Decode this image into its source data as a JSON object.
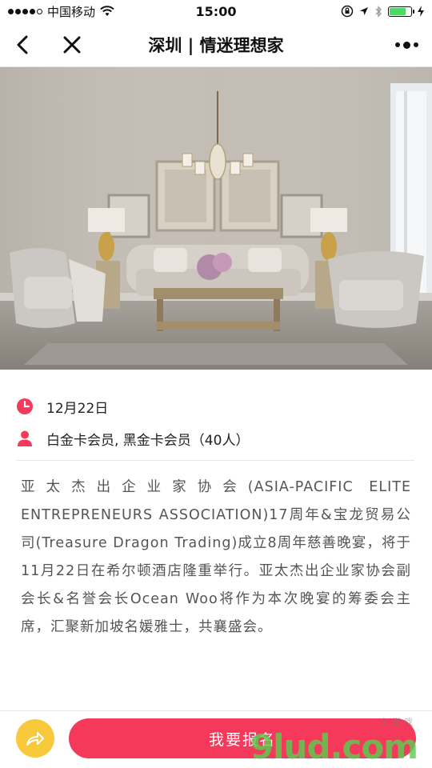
{
  "status_bar": {
    "carrier": "中国移动",
    "time": "15:00",
    "battery_level": 0.75,
    "icons": [
      "signal-dots-icon",
      "wifi-icon",
      "lock-rotation-icon",
      "location-arrow-icon",
      "bluetooth-icon",
      "battery-icon",
      "charging-icon"
    ]
  },
  "nav": {
    "title": "深圳 | 情迷理想家",
    "icons": [
      "back-arrow-icon",
      "close-icon",
      "more-dots-icon"
    ]
  },
  "event": {
    "date": "12月22日",
    "audience": "白金卡会员, 黑金卡会员（40人）",
    "description": "亚太杰出企业家协会(ASIA-PACIFIC ELITE ENTREPRENEURS ASSOCIATION)17周年&宝龙贸易公司(Treasure Dragon Trading)成立8周年慈善晚宴，将于11月22日在希尔顿酒店隆重举行。亚太杰出企业家协会副会长&名誉会长Ocean Woo将作为本次晚宴的筹委会主席，汇聚新加坡名媛雅士，共襄盛会。"
  },
  "actions": {
    "signup_label": "我要报名"
  },
  "watermark": {
    "text": "9lud.com",
    "sub": "久 游 戏"
  },
  "colors": {
    "accent": "#f5395b",
    "share": "#f7c93b",
    "battery": "#4cd964"
  }
}
